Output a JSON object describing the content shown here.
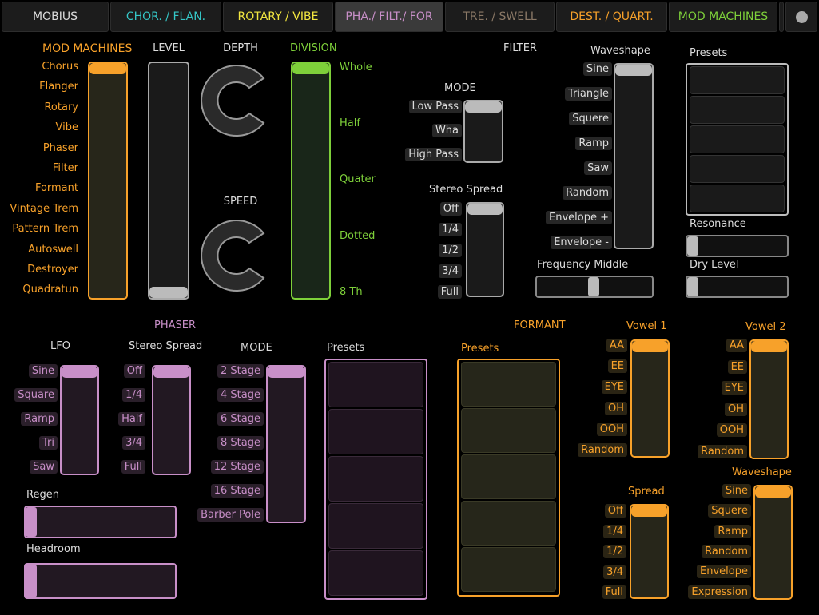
{
  "tabs": {
    "mobius": "MOBIUS",
    "chor": "CHOR. / FLAN.",
    "rotary": "ROTARY / VIBE",
    "pha": "PHA./ FILT./ FOR",
    "tre": "TRE. / SWELL",
    "dest": "DEST. / QUART.",
    "mod": "MOD MACHINES"
  },
  "colors": {
    "orange": "#f7a12a",
    "green": "#7ed03a",
    "purple": "#c88fc8",
    "yellow": "#f2e640",
    "cyan": "#35c6c6",
    "gray": "#cccccc"
  },
  "mod": {
    "title": "MOD MACHINES",
    "items": [
      "Chorus",
      "Flanger",
      "Rotary",
      "Vibe",
      "Phaser",
      "Filter",
      "Formant",
      "Vintage Trem",
      "Pattern Trem",
      "Autoswell",
      "Destroyer",
      "Quadratun"
    ],
    "level_label": "LEVEL",
    "depth_label": "DEPTH",
    "speed_label": "SPEED",
    "division_label": "DIVISION",
    "divisions": [
      "Whole",
      "Half",
      "Quater",
      "Dotted",
      "8 Th"
    ]
  },
  "filter": {
    "title": "FILTER",
    "mode_label": "MODE",
    "modes": [
      "Low Pass",
      "Wha",
      "High Pass"
    ],
    "stereo_label": "Stereo Spread",
    "stereo": [
      "Off",
      "1/4",
      "1/2",
      "3/4",
      "Full"
    ],
    "waveshape_label": "Waveshape",
    "waveshapes": [
      "Sine",
      "Triangle",
      "Squere",
      "Ramp",
      "Saw",
      "Random",
      "Envelope +",
      "Envelope -"
    ],
    "freq_label": "Frequency Middle",
    "presets_label": "Presets",
    "resonance_label": "Resonance",
    "dry_label": "Dry Level"
  },
  "phaser": {
    "title": "PHASER",
    "lfo_label": "LFO",
    "lfo": [
      "Sine",
      "Square",
      "Ramp",
      "Tri",
      "Saw"
    ],
    "stereo_label": "Stereo Spread",
    "stereo": [
      "Off",
      "1/4",
      "Half",
      "3/4",
      "Full"
    ],
    "mode_label": "MODE",
    "modes": [
      "2 Stage",
      "4 Stage",
      "6 Stage",
      "8 Stage",
      "12 Stage",
      "16 Stage",
      "Barber Pole"
    ],
    "presets_label": "Presets",
    "regen_label": "Regen",
    "headroom_label": "Headroom"
  },
  "formant": {
    "title": "FORMANT",
    "presets_label": "Presets",
    "vowel1_label": "Vowel 1",
    "vowel2_label": "Vowel 2",
    "vowels": [
      "AA",
      "EE",
      "EYE",
      "OH",
      "OOH",
      "Random"
    ],
    "spread_label": "Spread",
    "spread": [
      "Off",
      "1/4",
      "1/2",
      "3/4",
      "Full"
    ],
    "waveshape_label": "Waveshape",
    "waveshapes": [
      "Sine",
      "Squere",
      "Ramp",
      "Random",
      "Envelope",
      "Expression"
    ]
  }
}
